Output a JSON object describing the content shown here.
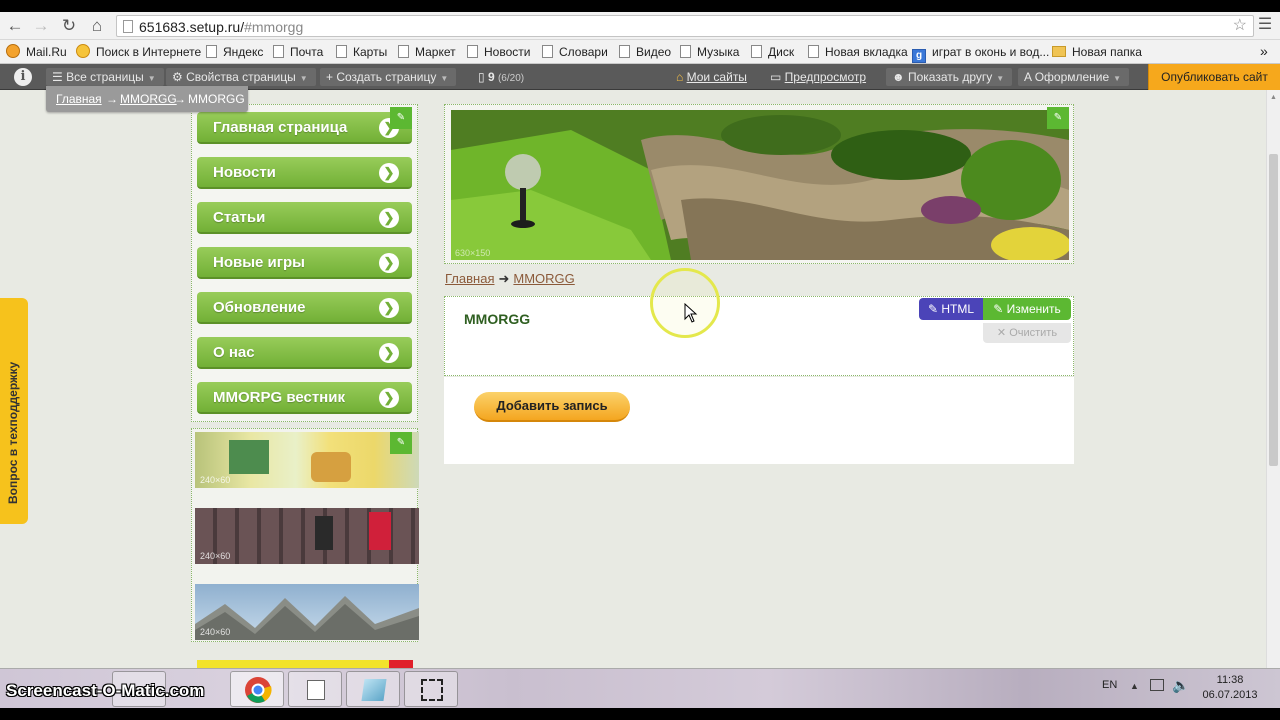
{
  "browser": {
    "url_host": "651683.setup.ru/",
    "url_hash": "#mmorgg",
    "bookmarks": [
      {
        "label": "Mail.Ru",
        "icon": "mail-icon"
      },
      {
        "label": "Поиск в Интернете",
        "icon": "search-icon"
      },
      {
        "label": "Яндекс",
        "icon": "page-icon"
      },
      {
        "label": "Почта",
        "icon": "page-icon"
      },
      {
        "label": "Карты",
        "icon": "page-icon"
      },
      {
        "label": "Маркет",
        "icon": "page-icon"
      },
      {
        "label": "Новости",
        "icon": "page-icon"
      },
      {
        "label": "Словари",
        "icon": "page-icon"
      },
      {
        "label": "Видео",
        "icon": "page-icon"
      },
      {
        "label": "Музыка",
        "icon": "page-icon"
      },
      {
        "label": "Диск",
        "icon": "page-icon"
      },
      {
        "label": "Новая вкладка",
        "icon": "page-icon"
      },
      {
        "label": "играт в оконь и вод...",
        "icon": "google-icon"
      },
      {
        "label": "Новая папка",
        "icon": "folder-icon"
      }
    ],
    "more_bookmarks": "»"
  },
  "toolbar": {
    "all_pages": "Все страницы",
    "page_props": "Свойства страницы",
    "create_page": "Создать страницу",
    "page_count": "9",
    "page_count_detail": "(6/20)",
    "my_sites": "Мои сайты",
    "preview": "Предпросмотр",
    "show_friend": "Показать другу",
    "design": "Оформление",
    "publish": "Опубликовать сайт"
  },
  "breadcrumb_tip": {
    "home": "Главная",
    "section": "MMORGG",
    "current": "MMORGG"
  },
  "sidebar": {
    "items": [
      {
        "label": "Главная страница"
      },
      {
        "label": "Новости"
      },
      {
        "label": "Статьи"
      },
      {
        "label": "Новые игры"
      },
      {
        "label": "Обновление"
      },
      {
        "label": "О нас"
      },
      {
        "label": "MMORPG вестник"
      }
    ],
    "thumb_size_label": "240×60"
  },
  "banner": {
    "size_label": "630×150"
  },
  "main": {
    "breadcrumb_home": "Главная",
    "breadcrumb_arrow": "➜",
    "breadcrumb_current": "MMORGG",
    "title": "MMORGG",
    "html_button": "HTML",
    "edit_button": "Изменить",
    "clear_button": "Очистить",
    "add_record": "Добавить запись"
  },
  "support_tab": "Вопрос в техподдержку",
  "taskbar": {
    "watermark": "Screencast-O-Matic.com",
    "lang": "EN",
    "time": "11:38",
    "date": "06.07.2013"
  }
}
